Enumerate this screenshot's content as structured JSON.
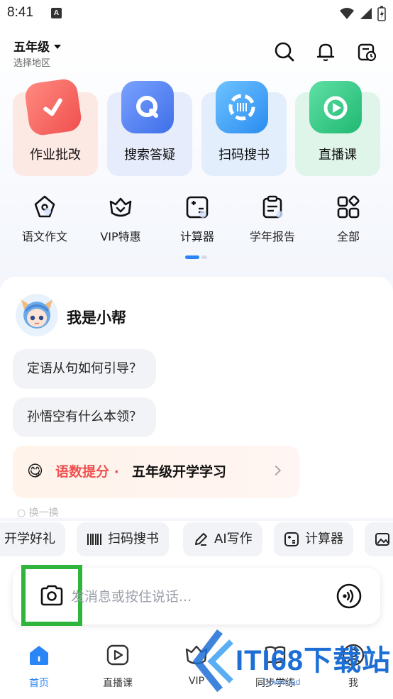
{
  "status_bar": {
    "time": "8:41",
    "notification_badge": "A"
  },
  "header": {
    "grade": "五年级",
    "region": "选择地区"
  },
  "big_tools": [
    {
      "label": "作业批改",
      "icon": "check-icon",
      "bg": "#fde9e4",
      "icon_color": "#f25f5c"
    },
    {
      "label": "搜索答疑",
      "icon": "search-q-icon",
      "bg": "#e6ecfb",
      "icon_color": "#4d7bf0"
    },
    {
      "label": "扫码搜书",
      "icon": "barcode-scan-icon",
      "bg": "#e2eefb",
      "icon_color": "#3b9cf2"
    },
    {
      "label": "直播课",
      "icon": "tv-play-icon",
      "bg": "#dff5ea",
      "icon_color": "#2cc57f"
    }
  ],
  "small_tools": [
    {
      "label": "语文作文",
      "icon": "pen-nib-icon"
    },
    {
      "label": "VIP特惠",
      "icon": "vip-crown-icon"
    },
    {
      "label": "计算器",
      "icon": "calculator-icon"
    },
    {
      "label": "学年报告",
      "icon": "report-icon"
    },
    {
      "label": "全部",
      "icon": "grid-all-icon"
    }
  ],
  "chat": {
    "bot_name": "我是小帮",
    "suggestions": [
      "定语从句如何引导？",
      "孙悟空有什么本领？"
    ],
    "promo": {
      "highlight": "语数提分 ·",
      "text": "五年级开学学习",
      "emoji": "😋"
    },
    "partial_text": "○ 换一换"
  },
  "chips": [
    {
      "label": "开学好礼",
      "icon": ""
    },
    {
      "label": "扫码搜书",
      "icon": "barcode-icon"
    },
    {
      "label": "AI写作",
      "icon": "pencil-icon"
    },
    {
      "label": "计算器",
      "icon": "calculator-icon"
    },
    {
      "label": "",
      "icon": "image-icon"
    }
  ],
  "input": {
    "placeholder": "发消息或按住说话..."
  },
  "tabs": [
    {
      "label": "首页",
      "icon": "home-icon",
      "active": true
    },
    {
      "label": "直播课",
      "icon": "play-circle-icon",
      "active": false
    },
    {
      "label": "VIP",
      "icon": "vip-icon",
      "active": false
    },
    {
      "label": "同步学练",
      "icon": "book-icon",
      "active": false
    },
    {
      "label": "我",
      "icon": "user-icon",
      "active": false
    }
  ],
  "watermark": {
    "text": "ITI68下载站",
    "sub": "Download"
  },
  "colors": {
    "accent": "#2a86f7",
    "highlight_box": "#2fb53c",
    "promo_red": "#f0504f"
  }
}
